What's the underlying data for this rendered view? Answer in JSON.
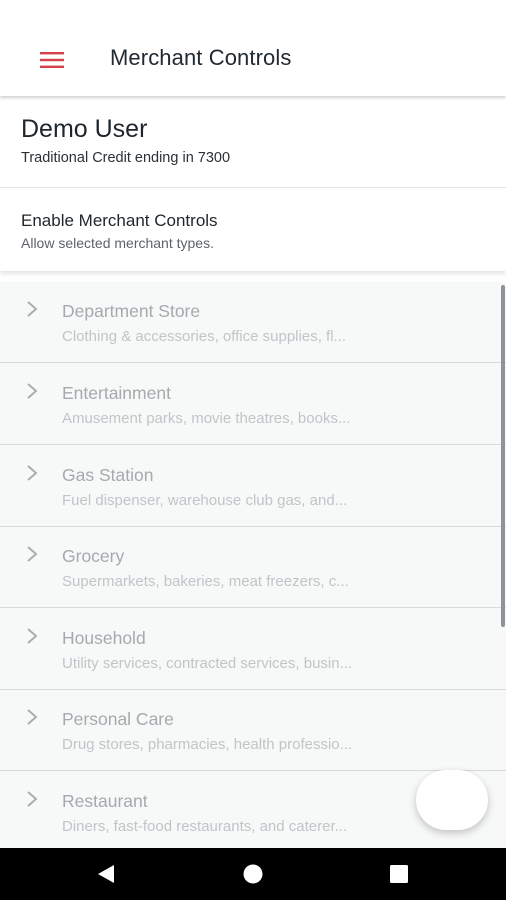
{
  "appbar": {
    "title": "Merchant Controls",
    "menu_icon": "hamburger-menu-icon",
    "accent_color": "#d6404a"
  },
  "account": {
    "name": "Demo User",
    "card": "Traditional Credit ending in 7300"
  },
  "enable_controls": {
    "title": "Enable Merchant Controls",
    "subtitle": "Allow selected merchant types.",
    "enabled": false
  },
  "categories": [
    {
      "title": "Department Store",
      "desc": "Clothing & accessories, office supplies, fl..."
    },
    {
      "title": "Entertainment",
      "desc": "Amusement parks, movie theatres, books..."
    },
    {
      "title": "Gas Station",
      "desc": "Fuel dispenser, warehouse club gas, and..."
    },
    {
      "title": "Grocery",
      "desc": "Supermarkets, bakeries, meat freezers, c..."
    },
    {
      "title": "Household",
      "desc": "Utility services, contracted services, busin..."
    },
    {
      "title": "Personal Care",
      "desc": "Drug stores, pharmacies, health professio..."
    },
    {
      "title": "Restaurant",
      "desc": "Diners, fast-food restaurants, and caterer..."
    }
  ],
  "navbar": {
    "back_icon": "back-triangle-icon",
    "home_icon": "home-circle-icon",
    "recents_icon": "recents-square-icon"
  }
}
